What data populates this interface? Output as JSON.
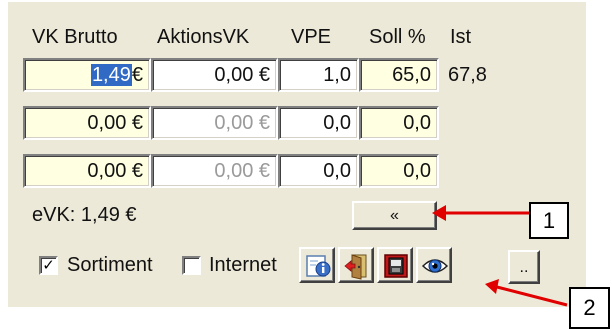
{
  "headers": {
    "vk_brutto": "VK Brutto",
    "aktions_vk": "AktionsVK",
    "vpe": "VPE",
    "soll": "Soll %",
    "ist": "Ist"
  },
  "rows": [
    {
      "vk_brutto_num": "1,49",
      "vk_brutto_cur": "€",
      "aktions_vk": "0,00 €",
      "vpe": "1,0",
      "soll": "65,0",
      "ist": "67,8"
    },
    {
      "vk_brutto": "0,00 €",
      "aktions_vk": "0,00 €",
      "vpe": "0,0",
      "soll": "0,0"
    },
    {
      "vk_brutto": "0,00 €",
      "aktions_vk": "0,00 €",
      "vpe": "0,0",
      "soll": "0,0"
    }
  ],
  "evk_label": "eVK: 1,49 €",
  "collapse_button": "«",
  "checkboxes": {
    "sortiment": {
      "label": "Sortiment",
      "checked": true,
      "mark": "✓"
    },
    "internet": {
      "label": "Internet",
      "checked": false
    }
  },
  "toolbar": {
    "more_button": "..",
    "icons": [
      "info-icon",
      "exit-door-icon",
      "stop-icon",
      "eye-icon"
    ]
  },
  "callouts": {
    "one": "1",
    "two": "2"
  },
  "colors": {
    "panel": "#ece9d8",
    "field_yellow": "#ffffe1",
    "selection": "#316ac5",
    "arrow": "#e00000"
  }
}
